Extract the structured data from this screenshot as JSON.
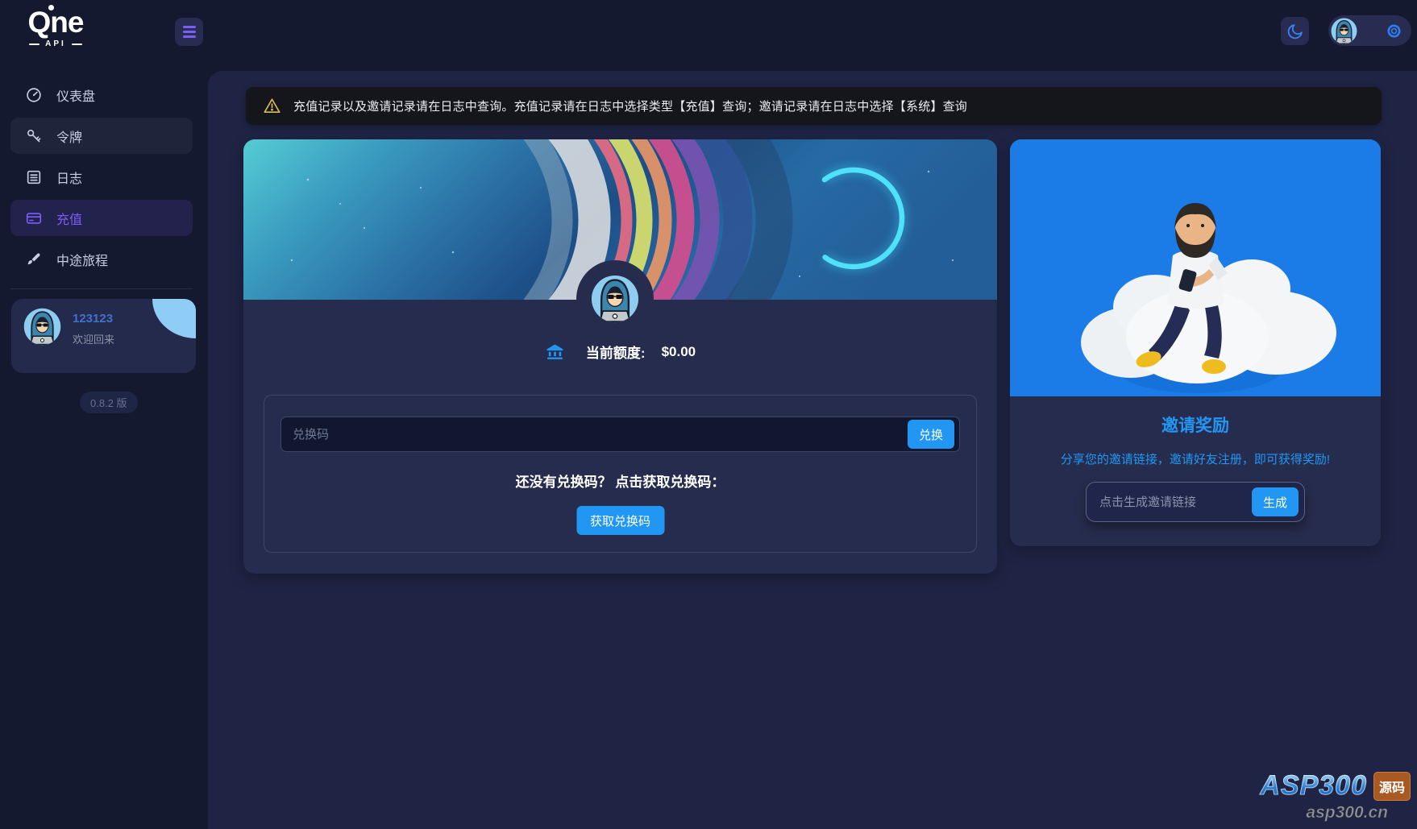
{
  "brand": {
    "name": "Qne",
    "sub": "API"
  },
  "sidebar": {
    "items": [
      {
        "label": "仪表盘",
        "icon": "gauge-icon"
      },
      {
        "label": "令牌",
        "icon": "key-icon"
      },
      {
        "label": "日志",
        "icon": "log-icon"
      },
      {
        "label": "充值",
        "icon": "credit-card-icon",
        "active": true
      },
      {
        "label": "中途旅程",
        "icon": "brush-icon"
      }
    ],
    "user": {
      "name": "123123",
      "greeting": "欢迎回来"
    },
    "version": "0.8.2 版"
  },
  "notice": "充值记录以及邀请记录请在日志中查询。充值记录请在日志中选择类型【充值】查询；邀请记录请在日志中选择【系统】查询",
  "recharge": {
    "balance_label": "当前额度:",
    "balance_value": "$0.00",
    "code_placeholder": "兑换码",
    "redeem_button": "兑换",
    "hint": "还没有兑换码？ 点击获取兑换码：",
    "get_code_button": "获取兑换码"
  },
  "invite": {
    "title": "邀请奖励",
    "subtitle": "分享您的邀请链接，邀请好友注册，即可获得奖励!",
    "input_placeholder": "点击生成邀请链接",
    "generate_button": "生成"
  },
  "watermark": {
    "name": "ASP300",
    "badge": "源码",
    "domain": "asp300.cn"
  },
  "colors": {
    "accent_purple": "#7c5dfa",
    "accent_blue": "#2196f3",
    "invite_panel_blue": "#1b7ce8",
    "warning_yellow": "#d9bd5e",
    "username_blue": "#4070d0"
  }
}
